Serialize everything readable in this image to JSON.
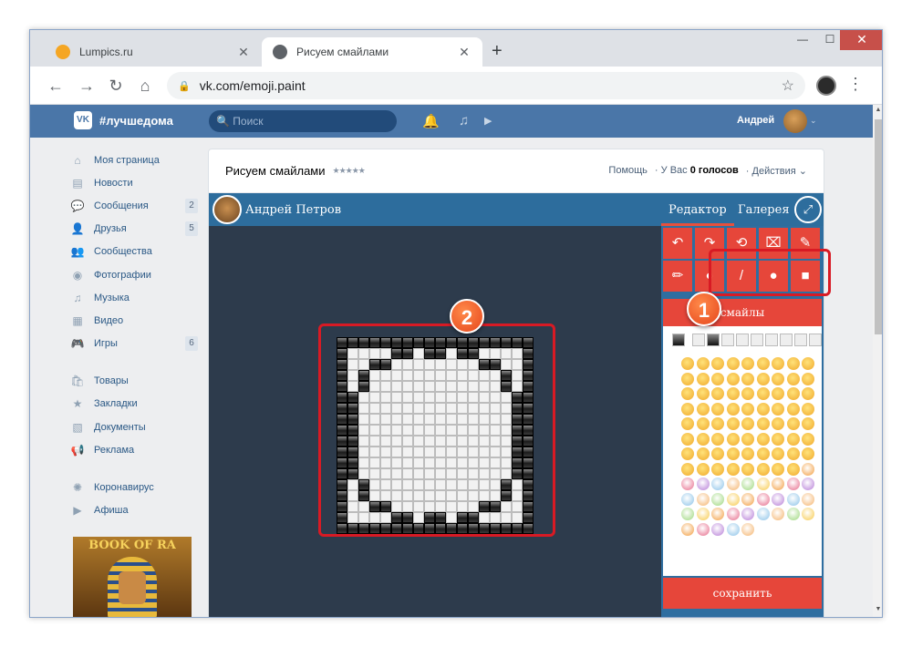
{
  "browser": {
    "tabs": [
      {
        "title": "Lumpics.ru",
        "favicon_color": "#f5a623",
        "close": "✕"
      },
      {
        "title": "Рисуем смайлами",
        "favicon_color": "#5f6368",
        "close": "✕"
      }
    ],
    "new_tab": "+",
    "window_controls": {
      "minimize": "—",
      "maximize": "☐",
      "close": "✕"
    },
    "nav": {
      "back": "←",
      "forward": "→",
      "reload": "↻",
      "home": "⌂"
    },
    "url": "vk.com/emoji.paint",
    "lock_icon": "lock-icon",
    "bookmark": "☆",
    "menu": "⋮"
  },
  "vk": {
    "logo": "VK",
    "hashtag": "#лучшедома",
    "search_placeholder": "Поиск",
    "user_name": "Андрей",
    "chevron": "⌄",
    "header_icons": {
      "bell": "🔔",
      "music": "♫",
      "play": "▶"
    }
  },
  "sidebar": {
    "items": [
      {
        "label": "Моя страница",
        "icon": "⌂",
        "count": null
      },
      {
        "label": "Новости",
        "icon": "▤",
        "count": null
      },
      {
        "label": "Сообщения",
        "icon": "💬",
        "count": "2"
      },
      {
        "label": "Друзья",
        "icon": "👤",
        "count": "5"
      },
      {
        "label": "Сообщества",
        "icon": "👥",
        "count": null
      },
      {
        "label": "Фотографии",
        "icon": "◉",
        "count": null
      },
      {
        "label": "Музыка",
        "icon": "♫",
        "count": null
      },
      {
        "label": "Видео",
        "icon": "▦",
        "count": null
      },
      {
        "label": "Игры",
        "icon": "🎮",
        "count": "6"
      }
    ],
    "items2": [
      {
        "label": "Товары",
        "icon": "🛍"
      },
      {
        "label": "Закладки",
        "icon": "★"
      },
      {
        "label": "Документы",
        "icon": "▧"
      },
      {
        "label": "Реклама",
        "icon": "📢"
      }
    ],
    "items3": [
      {
        "label": "Коронавирус",
        "icon": "✺"
      },
      {
        "label": "Афиша",
        "icon": "▶"
      }
    ],
    "ad_title": "BOOK OF RA"
  },
  "app": {
    "title": "Рисуем смайлами",
    "rating": "★★★★★",
    "help": "Помощь",
    "votes_prefix": "У Вас",
    "votes_value": "0 голосов",
    "actions": "Действия ⌄",
    "author": "Андрей Петров",
    "tab_editor": "Редактор",
    "tab_gallery": "Галерея",
    "fullscreen": "⤢",
    "tools_row1": [
      "↶",
      "↷",
      "⟲",
      "⌧",
      "✎"
    ],
    "tools_row2": [
      "✏",
      "◐",
      "/",
      "●",
      "■"
    ],
    "emoji_tab": "смайлы",
    "save": "сохранить",
    "colors": {
      "panel": "#2f6ea0",
      "tool": "#e6463a",
      "canvas_bg": "#2d3b4c",
      "highlight": "#d81a24"
    }
  },
  "annotations": {
    "badge1": "1",
    "badge2": "2"
  }
}
